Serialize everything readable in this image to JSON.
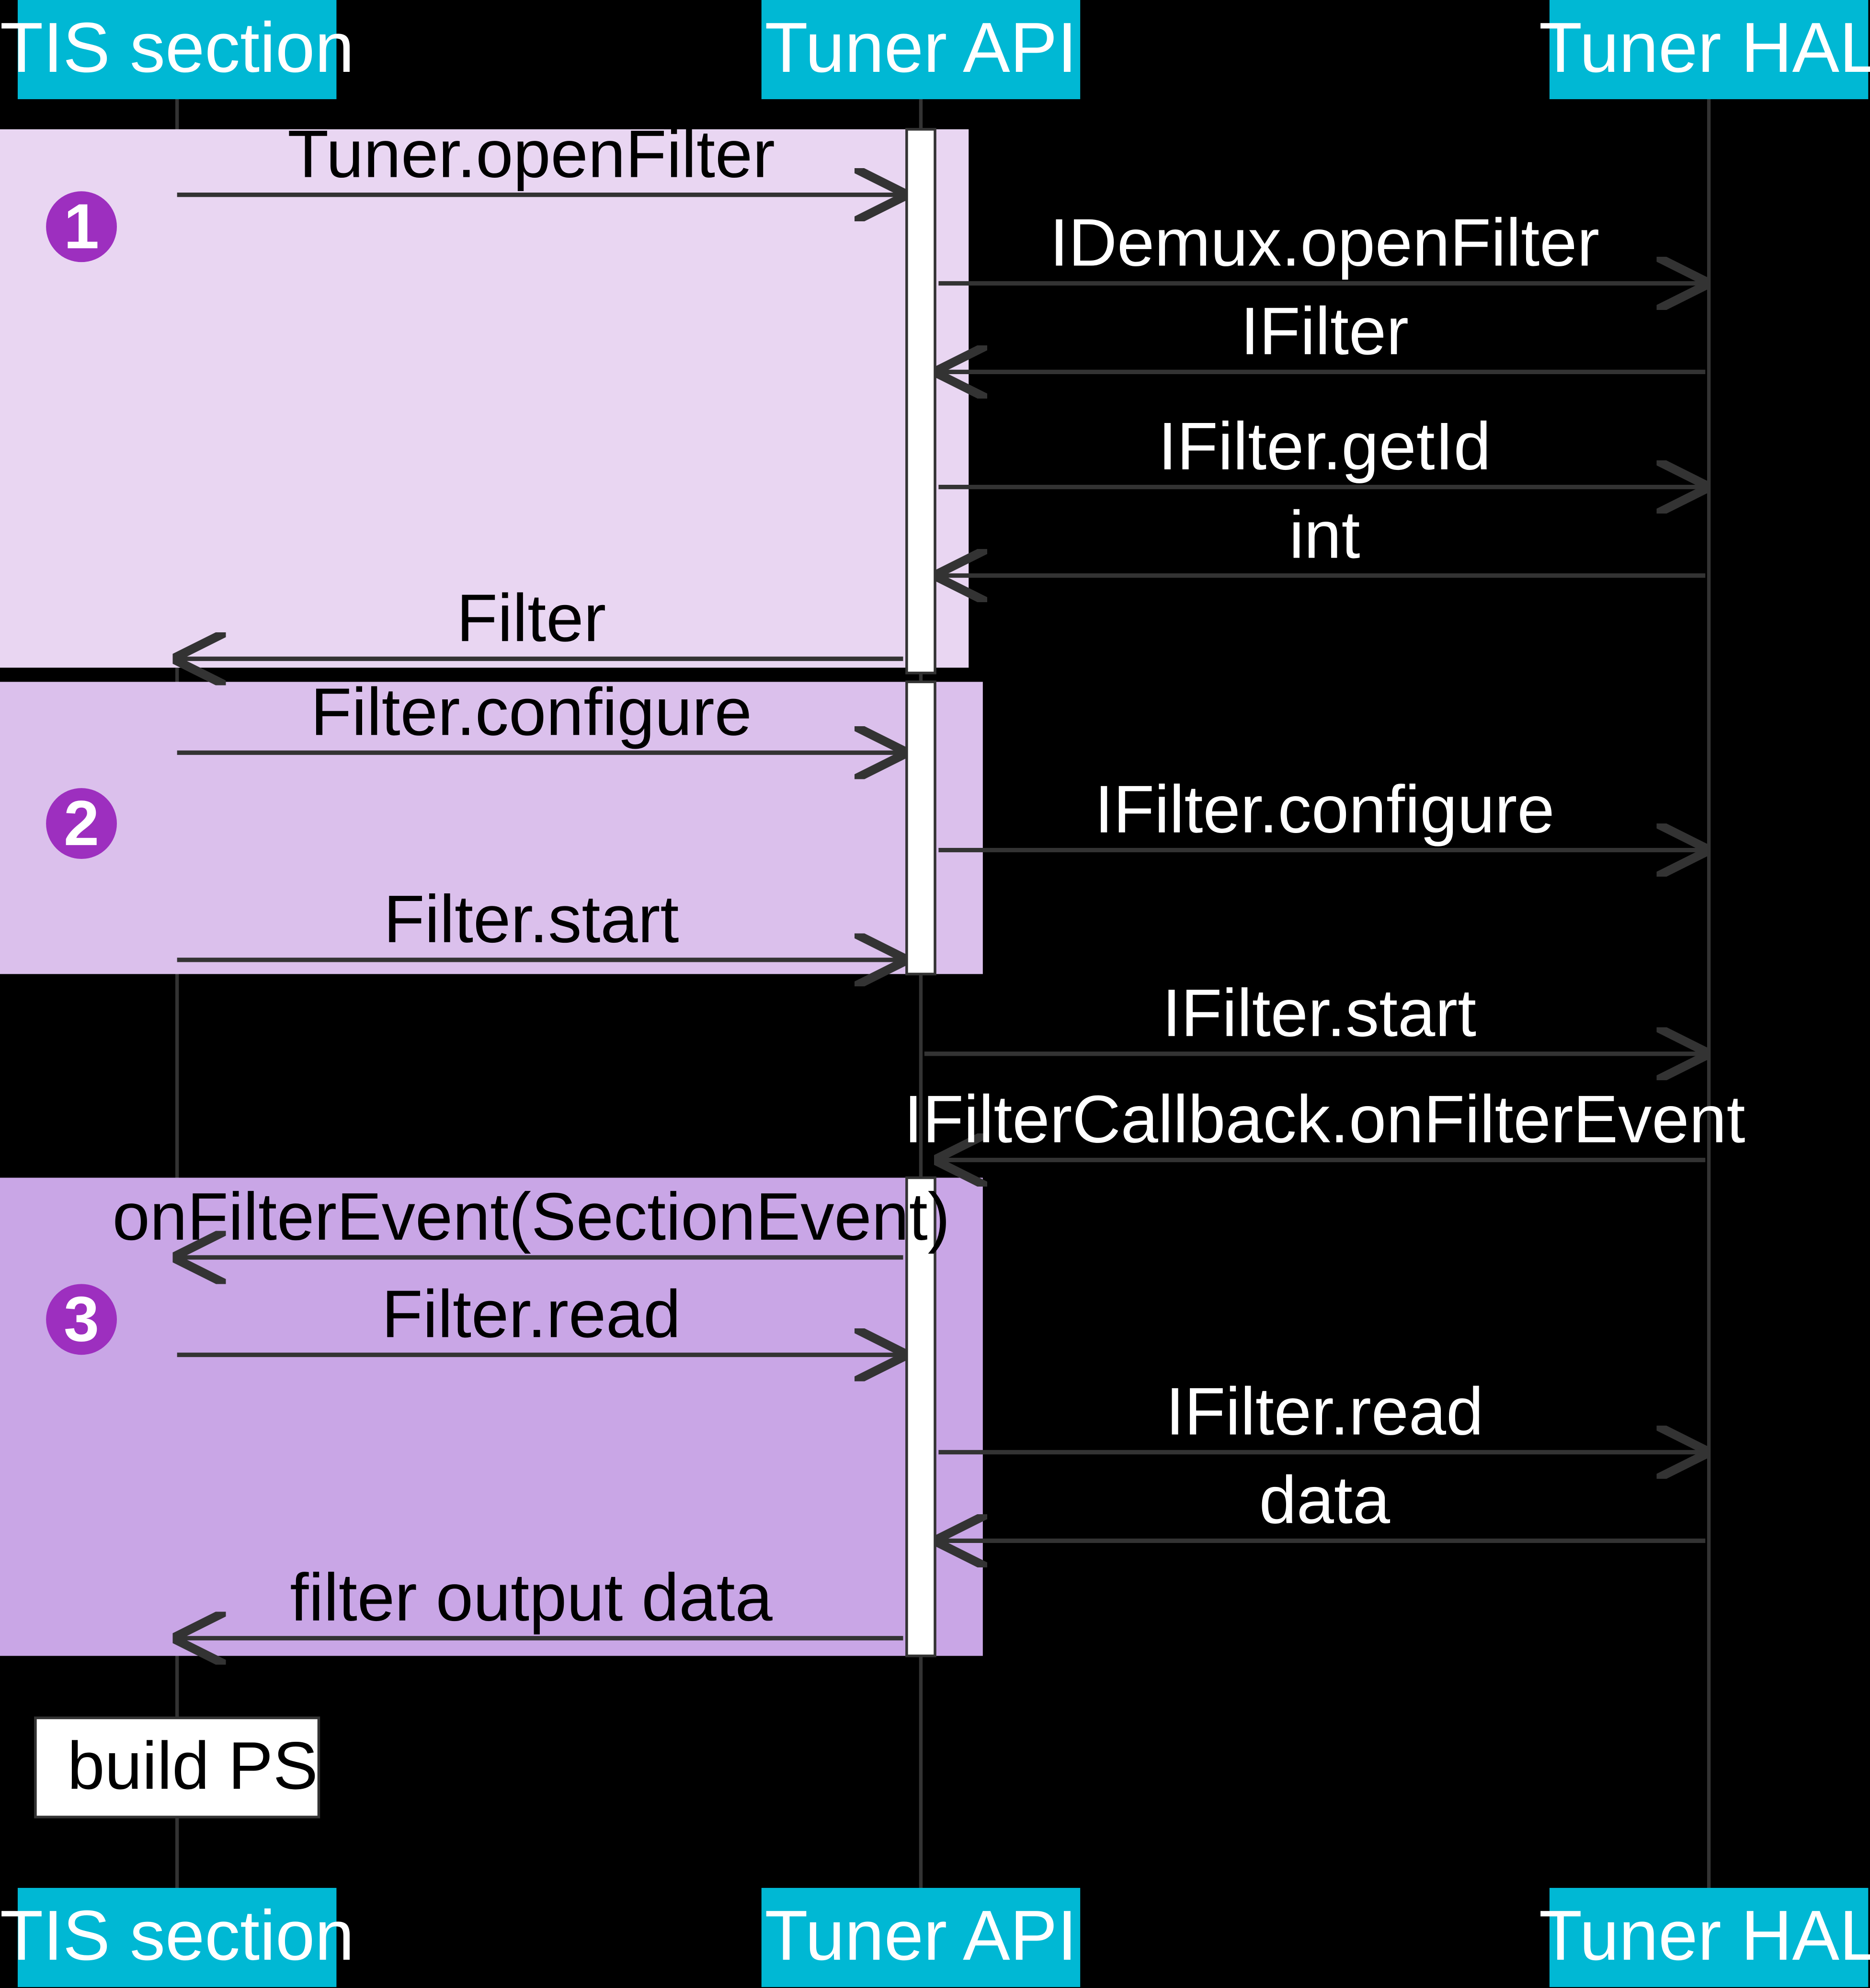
{
  "lanes": {
    "tis": "TIS section",
    "api": "Tuner API",
    "hal": "Tuner HAL"
  },
  "steps": {
    "s1": "1",
    "s2": "2",
    "s3": "3"
  },
  "messages": {
    "m_openFilter": "Tuner.openFilter",
    "m_openDemux": "IDemux.openFilter",
    "m_iFilter": "IFilter",
    "m_getId": "IFilter.getId",
    "m_int": "int",
    "m_Filter": "Filter",
    "m_configure": "Filter.configure",
    "m_iConfigure": "IFilter.configure",
    "m_start": "Filter.start",
    "m_iStart": "IFilter.start",
    "m_onFilterEventHal": "IFilterCallback.onFilterEvent",
    "m_onFilterEvent": "onFilterEvent(SectionEvent)",
    "m_read": "Filter.read",
    "m_iRead": "IFilter.read",
    "m_data": "data",
    "m_filterOutput": "filter output data"
  },
  "note": "build PSI"
}
